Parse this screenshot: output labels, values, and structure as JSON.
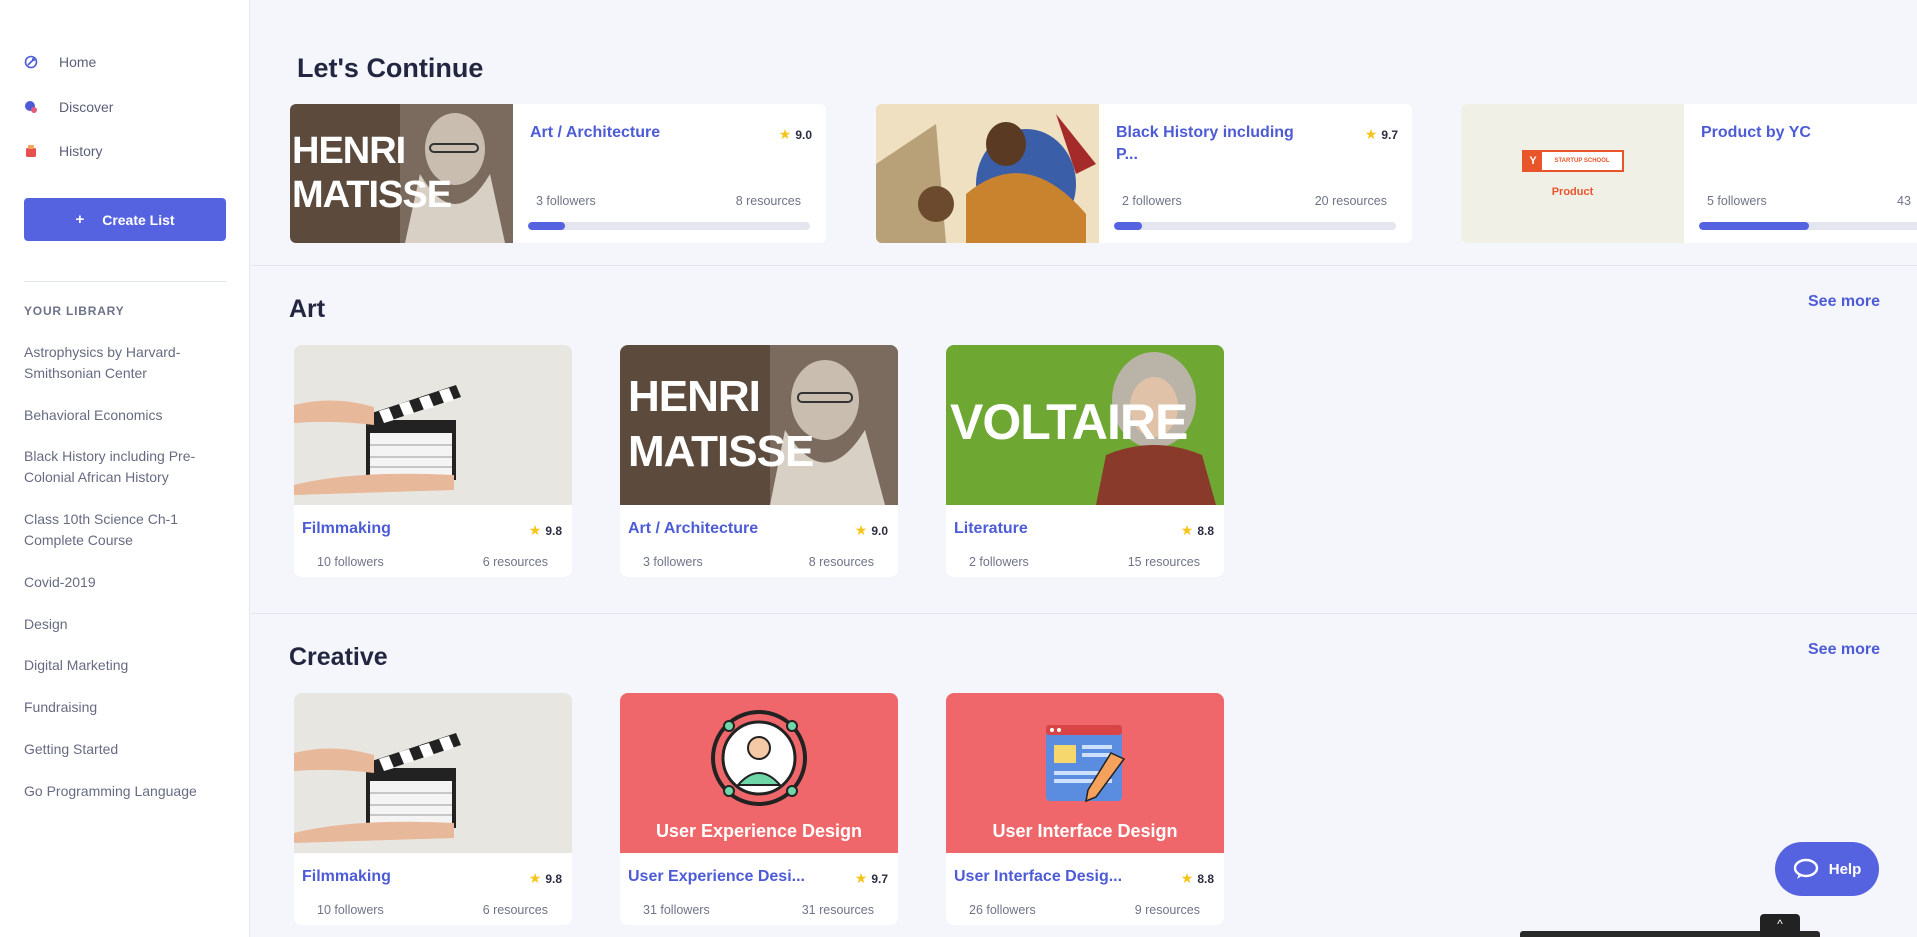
{
  "sidebar": {
    "nav": [
      {
        "label": "Home",
        "icon": "rocket-icon"
      },
      {
        "label": "Discover",
        "icon": "discover-icon"
      },
      {
        "label": "History",
        "icon": "history-icon"
      }
    ],
    "create_button": "Create List",
    "create_plus": "+",
    "library_heading": "YOUR LIBRARY",
    "library": [
      "Astrophysics by Harvard-Smithsonian Center",
      "Behavioral Economics",
      "Black History including Pre-Colonial African History",
      "Class 10th Science Ch-1 Complete Course",
      "Covid-2019",
      "Design",
      "Digital Marketing",
      "Fundraising",
      "Getting Started",
      "Go Programming Language"
    ]
  },
  "continue": {
    "title": "Let's Continue",
    "cards": [
      {
        "title": "Art / Architecture",
        "rating": "9.0",
        "followers": "3 followers",
        "resources": "8 resources",
        "progress": 0.13,
        "thumb_text": [
          "HENRI",
          "MATISSE"
        ]
      },
      {
        "title": "Black History including P...",
        "rating": "9.7",
        "followers": "2 followers",
        "resources": "20 resources",
        "progress": 0.1
      },
      {
        "title": "Product by YC",
        "rating": "",
        "followers": "5 followers",
        "resources": "43",
        "progress": 0.44,
        "thumb_badge": "STARTUP SCHOOL",
        "thumb_badge_y": "Y",
        "thumb_caption": "Product"
      }
    ]
  },
  "art": {
    "title": "Art",
    "see_more": "See more",
    "cards": [
      {
        "title": "Filmmaking",
        "rating": "9.8",
        "followers": "10 followers",
        "resources": "6 resources"
      },
      {
        "title": "Art / Architecture",
        "rating": "9.0",
        "followers": "3 followers",
        "resources": "8 resources",
        "thumb_text": [
          "HENRI",
          "MATISSE"
        ]
      },
      {
        "title": "Literature",
        "rating": "8.8",
        "followers": "2 followers",
        "resources": "15 resources",
        "thumb_text": [
          "VOLTAIRE"
        ]
      }
    ]
  },
  "creative": {
    "title": "Creative",
    "see_more": "See more",
    "cards": [
      {
        "title": "Filmmaking",
        "rating": "9.8",
        "followers": "10 followers",
        "resources": "6 resources"
      },
      {
        "title": "User Experience Desi...",
        "rating": "9.7",
        "followers": "31 followers",
        "resources": "31 resources",
        "thumb_caption": "User Experience Design"
      },
      {
        "title": "User Interface Desig...",
        "rating": "8.8",
        "followers": "26 followers",
        "resources": "9 resources",
        "thumb_caption": "User Interface Design"
      }
    ]
  },
  "help": {
    "label": "Help"
  },
  "bottom_tab": {
    "label": "^"
  },
  "colors": {
    "accent": "#5663e0",
    "link": "#4d5cd6",
    "star": "#f5c518",
    "coral": "#f0676b",
    "clapper_bg": "#e6e4df",
    "matisse_bg": "#5c4a3c",
    "voltaire_bg": "#6ea832"
  }
}
